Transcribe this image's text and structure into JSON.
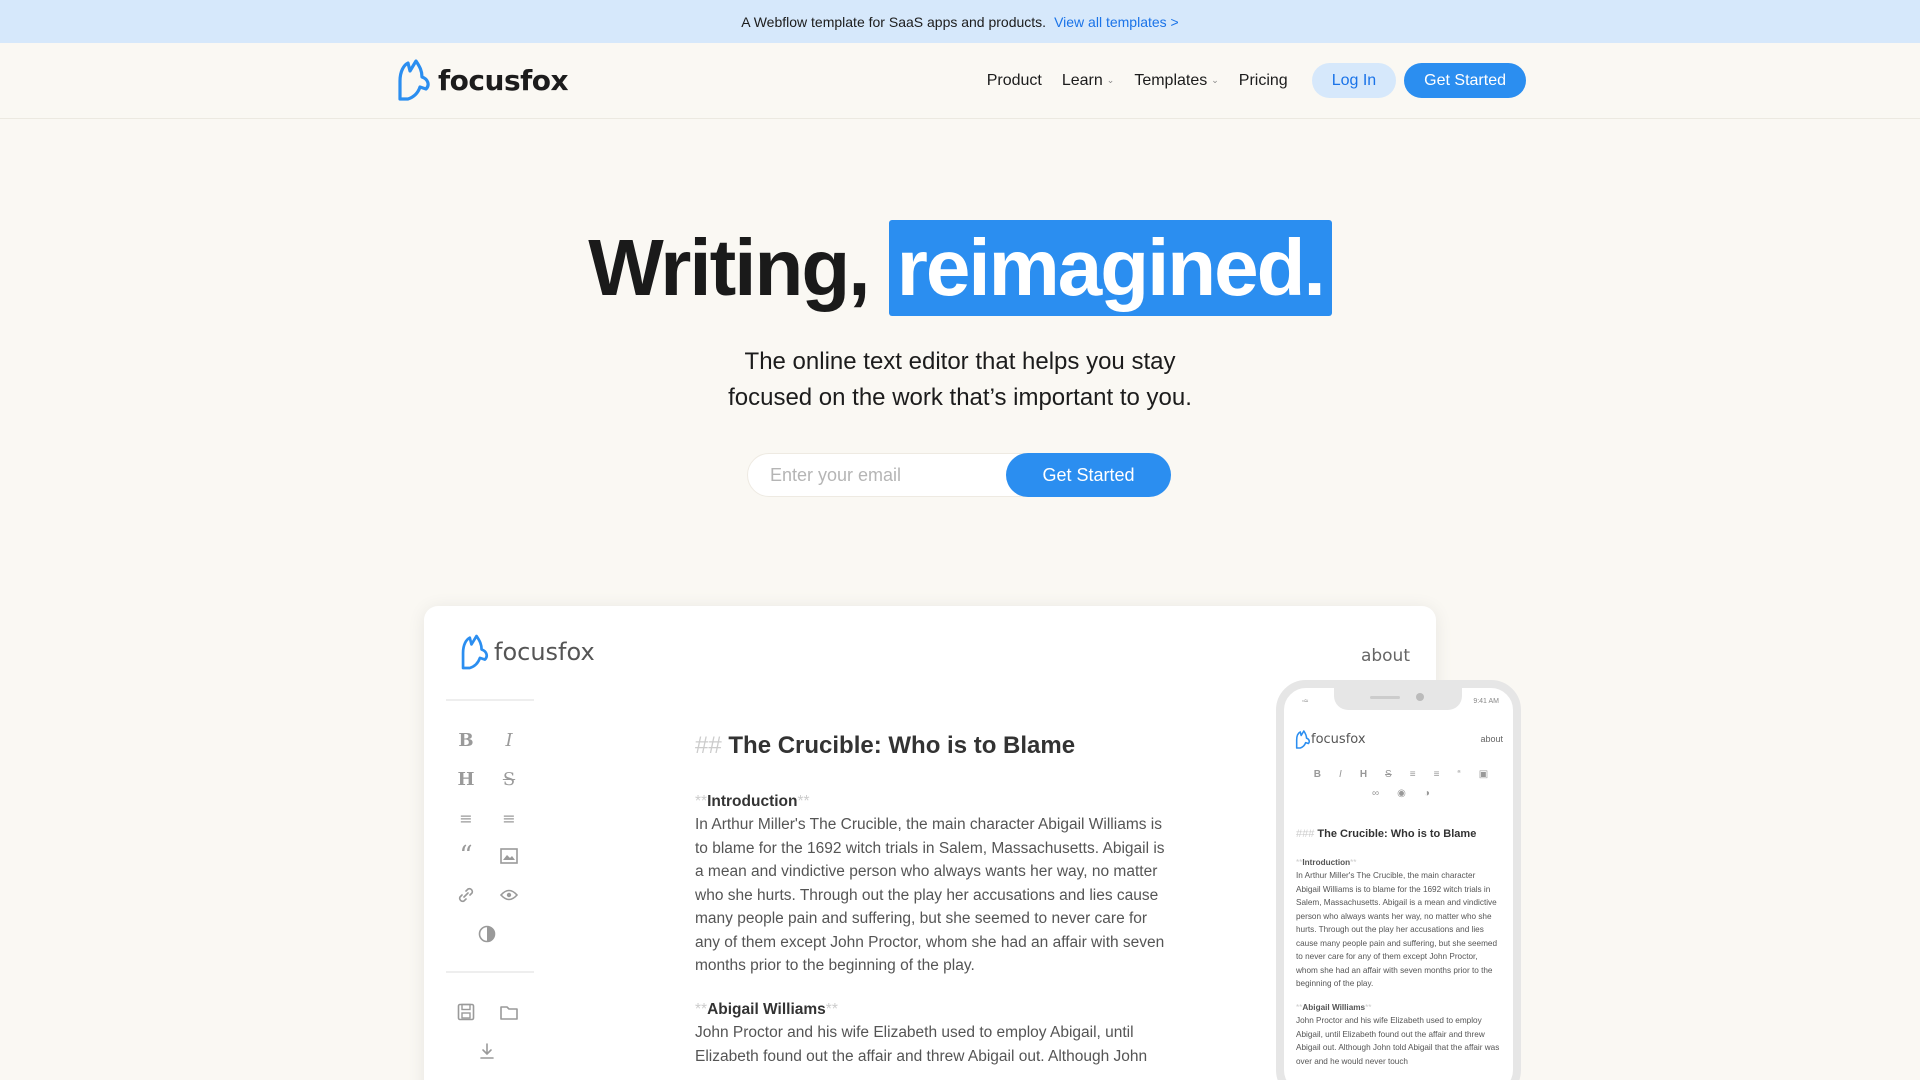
{
  "banner": {
    "text": "A Webflow template for SaaS apps and products.",
    "link": "View all templates >"
  },
  "nav": {
    "brand": "focusfox",
    "links": [
      {
        "label": "Product"
      },
      {
        "label": "Learn"
      },
      {
        "label": "Templates"
      },
      {
        "label": "Pricing"
      }
    ],
    "login": "Log In",
    "cta": "Get Started"
  },
  "hero": {
    "title_plain": "Writing,",
    "title_highlight": "reimagined.",
    "subtitle_line1": "The online text editor that helps you stay",
    "subtitle_line2": "focused on the work that’s important to you.",
    "email_placeholder": "Enter your email",
    "cta": "Get Started"
  },
  "app": {
    "brand": "focusfox",
    "about": "about",
    "heading_marker": "##",
    "heading": "The Crucible: Who is to Blame",
    "sections": [
      {
        "title": "Introduction",
        "body": "In Arthur Miller's The Crucible, the main character Abigail Williams is to blame for the 1692 witch trials in Salem, Massachusetts. Abigail is a mean and vindictive person who always wants her way, no matter who she hurts. Through out the play her accusations and lies cause many people pain and suffering, but she seemed to never care for any of them except John Proctor, whom she had an affair with seven months prior to the beginning of the play."
      },
      {
        "title": "Abigail Williams",
        "body": "John Proctor and his wife Elizabeth used to employ Abigail, until Elizabeth found out the affair and threw Abigail out. Although John"
      }
    ]
  },
  "phone": {
    "time": "9:41 AM",
    "brand": "focusfox",
    "about": "about",
    "heading_marker": "###",
    "heading": "The Crucible: Who is to Blame",
    "intro_title": "Introduction",
    "intro_body": "In Arthur Miller's The Crucible, the main character Abigail Williams is to blame for the 1692 witch trials in Salem, Massachusetts. Abigail is a mean and vindictive person who always wants her way, no matter who she hurts. Through out the play her accusations and lies cause many people pain and suffering, but she seemed to never care for any of them except John Proctor, whom she had an affair with seven months prior to the beginning of the play.",
    "section2_title": "Abigail Williams",
    "section2_body": "John Proctor and his wife Elizabeth used to employ Abigail, until Elizabeth found out the affair and threw Abigail out. Although John told Abigail that the affair was over and he would never touch"
  },
  "colors": {
    "accent": "#2b8ef0",
    "banner_bg": "#d6e8fb",
    "page_bg": "#faf8f3"
  }
}
